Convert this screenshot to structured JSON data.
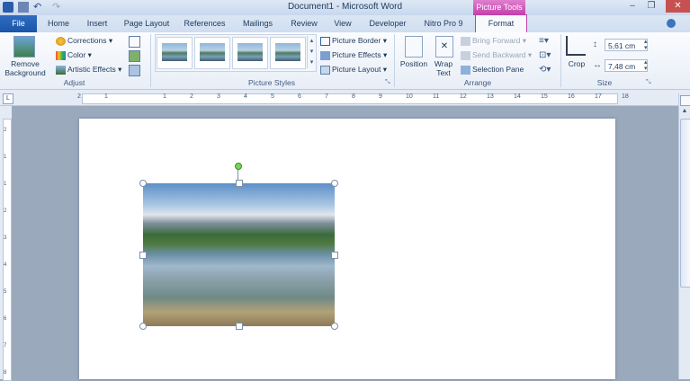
{
  "window": {
    "title": "Document1 - Microsoft Word",
    "context_tab_group": "Picture Tools"
  },
  "tabs": [
    "File",
    "Home",
    "Insert",
    "Page Layout",
    "References",
    "Mailings",
    "Review",
    "View",
    "Developer",
    "Nitro Pro 9",
    "Format"
  ],
  "ribbon": {
    "remove_background": "Remove Background",
    "adjust": {
      "corrections": "Corrections",
      "color": "Color",
      "artistic_effects": "Artistic Effects",
      "label": "Adjust"
    },
    "picture_styles": {
      "label": "Picture Styles",
      "border": "Picture Border",
      "effects": "Picture Effects",
      "layout": "Picture Layout"
    },
    "arrange": {
      "position": "Position",
      "wrap_text": "Wrap Text",
      "bring_forward": "Bring Forward",
      "send_backward": "Send Backward",
      "selection_pane": "Selection Pane",
      "label": "Arrange"
    },
    "size": {
      "crop": "Crop",
      "height": "5,61 cm",
      "width": "7,48 cm",
      "label": "Size"
    }
  },
  "ruler": {
    "h_numbers": [
      "2",
      "1",
      "1",
      "2",
      "3",
      "4",
      "5",
      "6",
      "7",
      "8",
      "9",
      "10",
      "11",
      "12",
      "13",
      "14",
      "15",
      "16",
      "17",
      "18"
    ],
    "v_numbers": [
      "2",
      "1",
      "1",
      "2",
      "3",
      "4",
      "5",
      "6",
      "7",
      "8"
    ]
  }
}
